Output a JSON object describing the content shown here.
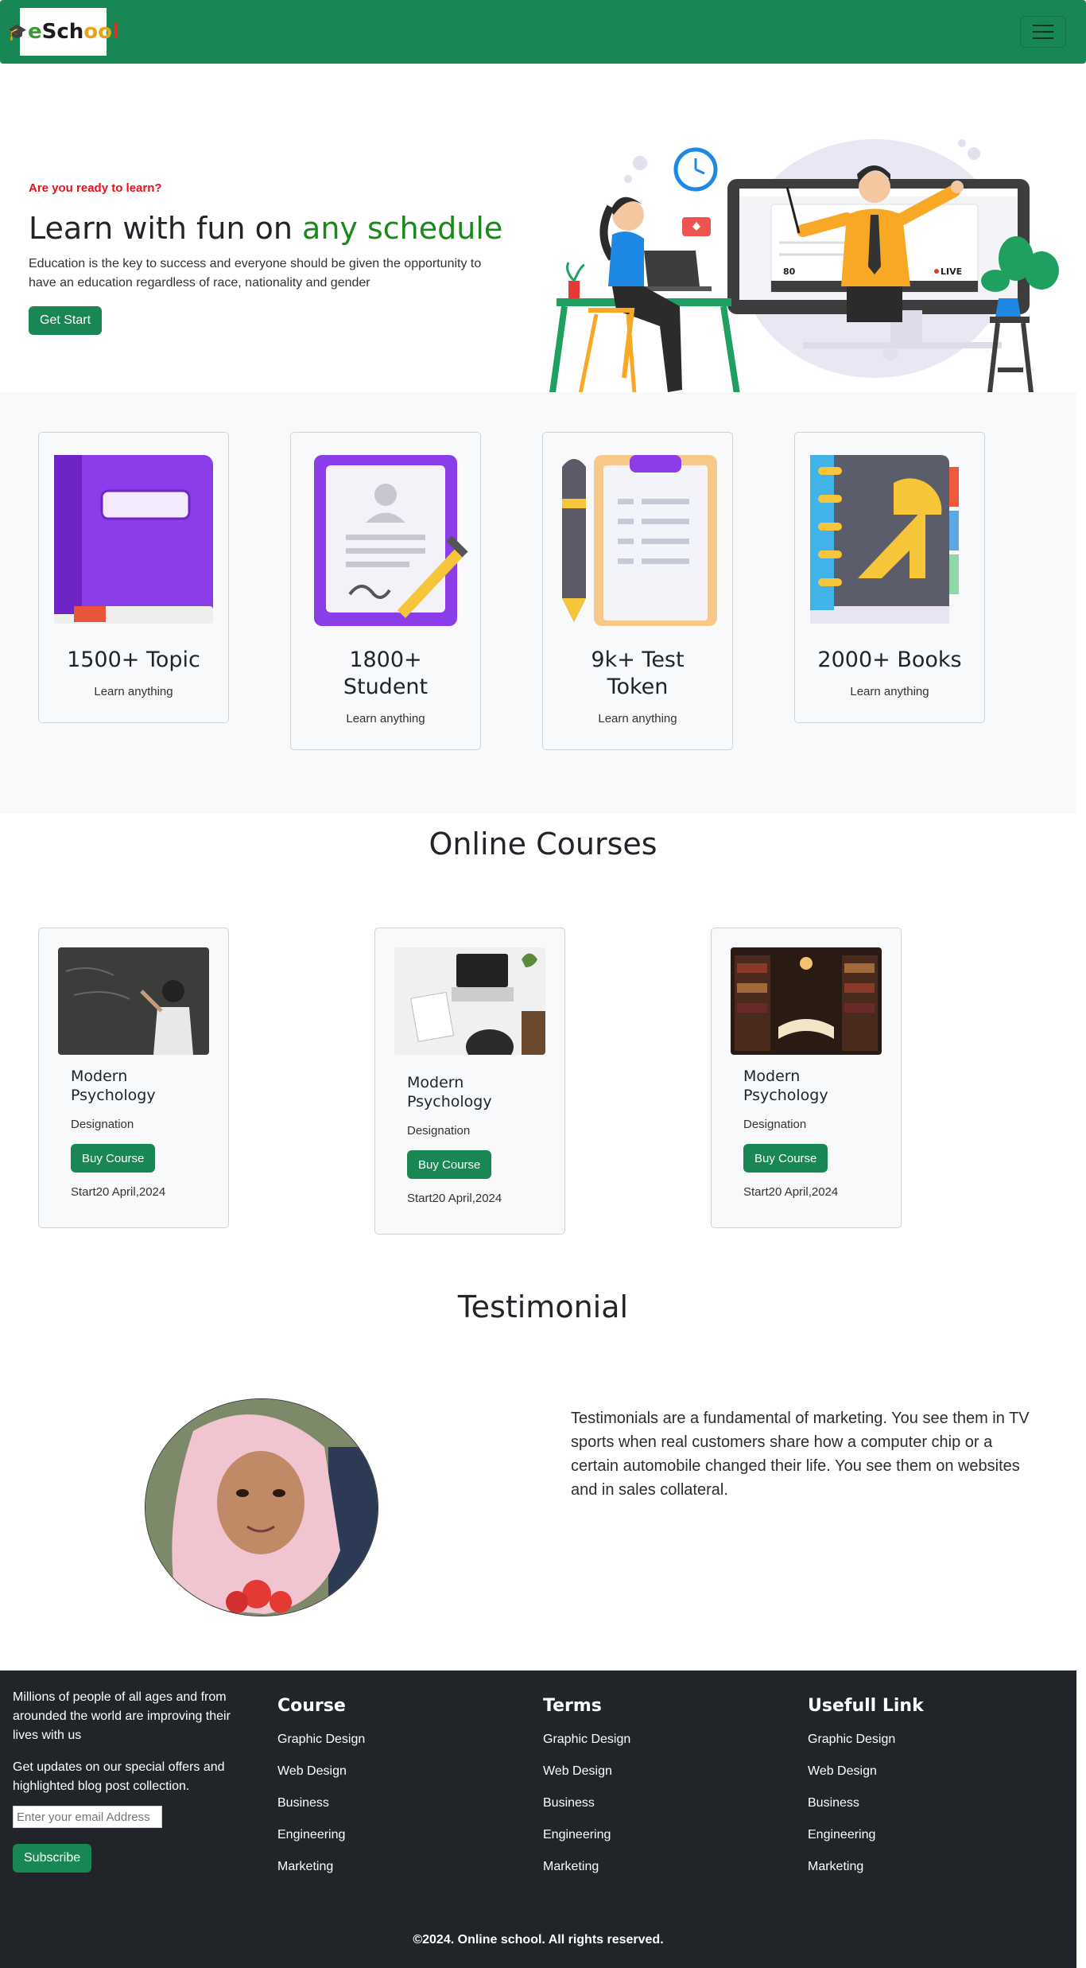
{
  "navbar": {
    "logo_text": "eSchool",
    "toggler_icon": "hamburger-icon"
  },
  "hero": {
    "eyebrow": "Are you ready to learn?",
    "title_plain": "Learn with fun on ",
    "title_highlight": "any schedule",
    "description": "Education is the key to success and everyone should be given the opportunity to have an education regardless of race, nationality and gender",
    "button": "Get Start",
    "accent_color": "#198a1a",
    "eyebrow_color": "#e8101b",
    "illustration": {
      "screen_views": "80",
      "screen_badge": "LIVE"
    }
  },
  "stats": [
    {
      "value": "1500+ Topic",
      "caption": "Learn anything",
      "icon": "book-icon"
    },
    {
      "value": "1800+ Student",
      "caption": "Learn anything",
      "icon": "student-document-icon"
    },
    {
      "value": "9k+ Test Token",
      "caption": "Learn anything",
      "icon": "clipboard-pen-icon"
    },
    {
      "value": "2000+ Books",
      "caption": "Learn anything",
      "icon": "notebook-ruler-icon"
    }
  ],
  "courses": {
    "title": "Online Courses",
    "items": [
      {
        "name": "Modern Psychology",
        "designation": "Designation",
        "button": "Buy Course",
        "date": "Start20 April,2024",
        "image": "chalkboard-photo"
      },
      {
        "name": "Modern Psychology",
        "designation": "Designation",
        "button": "Buy Course",
        "date": "Start20 April,2024",
        "image": "laptop-desk-photo"
      },
      {
        "name": "Modern Psychology",
        "designation": "Designation",
        "button": "Buy Course",
        "date": "Start20 April,2024",
        "image": "library-photo"
      }
    ]
  },
  "testimonial": {
    "title": "Testimonial",
    "text": "Testimonials are a fundamental of marketing. You see them in TV sports when real customers share how a computer chip or a certain automobile changed their life. You see them on websites and in sales collateral."
  },
  "footer": {
    "intro": "Millions of people of all ages and from arounded the world are improving their lives with us",
    "updates": "Get updates on our special offers and highlighted blog post collection.",
    "email_placeholder": "Enter your email Address",
    "subscribe": "Subscribe",
    "columns": [
      {
        "title": "Course",
        "links": [
          "Graphic Design",
          "Web Design",
          "Business",
          "Engineering",
          "Marketing"
        ]
      },
      {
        "title": "Terms",
        "links": [
          "Graphic Design",
          "Web Design",
          "Business",
          "Engineering",
          "Marketing"
        ]
      },
      {
        "title": "Usefull Link",
        "links": [
          "Graphic Design",
          "Web Design",
          "Business",
          "Engineering",
          "Marketing"
        ]
      }
    ],
    "copyright": "©2024. Online school. All rights reserved."
  },
  "colors": {
    "brand_green": "#198754",
    "footer_bg": "#212529",
    "section_bg": "#f8f9fa"
  }
}
